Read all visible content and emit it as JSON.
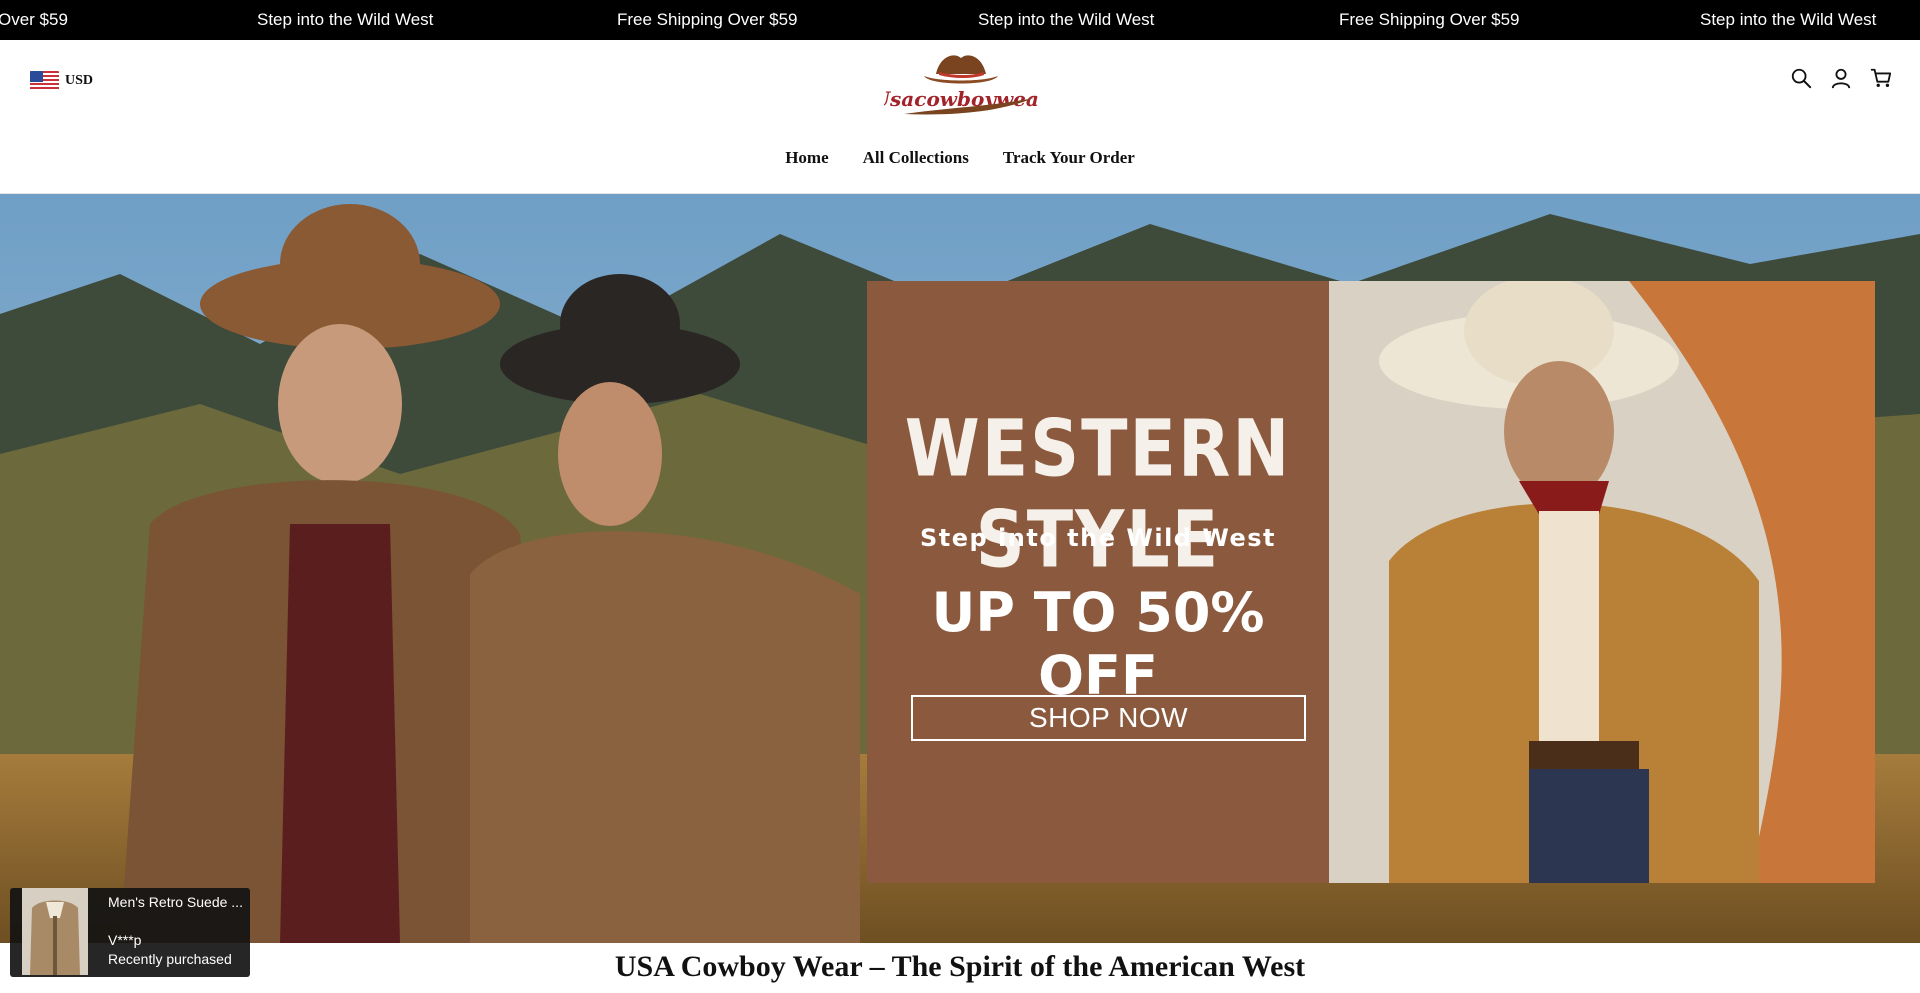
{
  "announcement": {
    "messages": [
      "Free Shipping Over $59",
      "Step into the Wild West",
      "Free Shipping Over $59",
      "Step into the Wild West",
      "Free Shipping Over $59",
      "Step into the Wild West"
    ],
    "partial_first": "Over $59"
  },
  "header": {
    "currency": "USD",
    "logo_text": "Usacowboywear",
    "icons": [
      "search-icon",
      "account-icon",
      "cart-icon"
    ]
  },
  "nav": {
    "items": [
      {
        "label": "Home"
      },
      {
        "label": "All Collections"
      },
      {
        "label": "Track Your Order"
      }
    ]
  },
  "hero": {
    "title": "WESTERN STYLE",
    "subtitle": "Step into the Wild West",
    "offer": "UP TO 50% OFF",
    "cta": "SHOP NOW"
  },
  "section": {
    "heading": "USA Cowboy Wear – The Spirit of the American West"
  },
  "popup": {
    "product": "Men's Retro Suede ...",
    "buyer": "V***p",
    "status": "Recently purchased"
  },
  "colors": {
    "announcement_bg": "#000000",
    "promo_panel": "#8b5a3e",
    "logo_red": "#a3232a",
    "logo_brown": "#7a4420"
  }
}
